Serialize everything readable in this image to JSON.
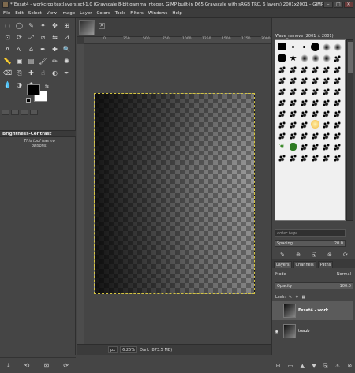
{
  "window": {
    "title": "*[Exsat4 - workcrop textlayers.xcf-1.0 (Grayscale 8-bit gamma integer, GIMP built-in D65 Grayscale with sRGB TRC, 6 layers) 2001x2001 – GIMP",
    "minimize": "–",
    "maximize": "□",
    "close": "✕"
  },
  "menu": [
    "File",
    "Edit",
    "Select",
    "View",
    "Image",
    "Layer",
    "Colors",
    "Tools",
    "Filters",
    "Windows",
    "Help"
  ],
  "toolbox": {
    "tools": [
      "rect-select",
      "ellipse-select",
      "free-select",
      "fuzzy-select",
      "move",
      "align",
      "crop",
      "rotate",
      "scale",
      "shear",
      "flip",
      "perspective",
      "text",
      "warp",
      "cage",
      "paths",
      "color-picker",
      "zoom",
      "measure",
      "bucket",
      "gradient",
      "paintbrush",
      "pencil",
      "airbrush",
      "eraser",
      "clone",
      "heal",
      "smudge",
      "dodge",
      "ink",
      "blur",
      "dodge-burn",
      "mypaint",
      "",
      ""
    ],
    "tool_glyphs": [
      "⬚",
      "◯",
      "✎",
      "✦",
      "✥",
      "⊞",
      "⊡",
      "⟳",
      "⤢",
      "⧄",
      "⇋",
      "⊿",
      "A",
      "∿",
      "⌂",
      "✒",
      "✚",
      "🔍",
      "📏",
      "▣",
      "▤",
      "🖌",
      "✏",
      "✺",
      "⌫",
      "⎘",
      "✚",
      "☝",
      "◐",
      "✒",
      "💧",
      "◑",
      "✿",
      "",
      ""
    ],
    "options_title": "Brightness-Contrast",
    "options_msg": "This tool has no options."
  },
  "canvas": {
    "ruler_labels": [
      "0",
      "250",
      "500",
      "750",
      "1000",
      "1250",
      "1500",
      "1750",
      "2000"
    ],
    "unit": "px",
    "zoom": "6.25%",
    "status": "Dark (873.5 MB)"
  },
  "brushes": {
    "title": "Wave_remove (2001 × 2001)",
    "tag_placeholder": "enter tags",
    "spacing_label": "Spacing",
    "spacing_value": "20.0"
  },
  "layers": {
    "tabs": [
      "Layers",
      "Channels",
      "Paths"
    ],
    "mode_label": "Mode",
    "mode_value": "Normal",
    "opacity_label": "Opacity",
    "opacity_value": "100.0",
    "lock_label": "Lock:",
    "items": [
      {
        "name": "Exsat4 - work",
        "visible": false,
        "selected": true
      },
      {
        "name": "toaub",
        "visible": true,
        "selected": false
      }
    ]
  }
}
